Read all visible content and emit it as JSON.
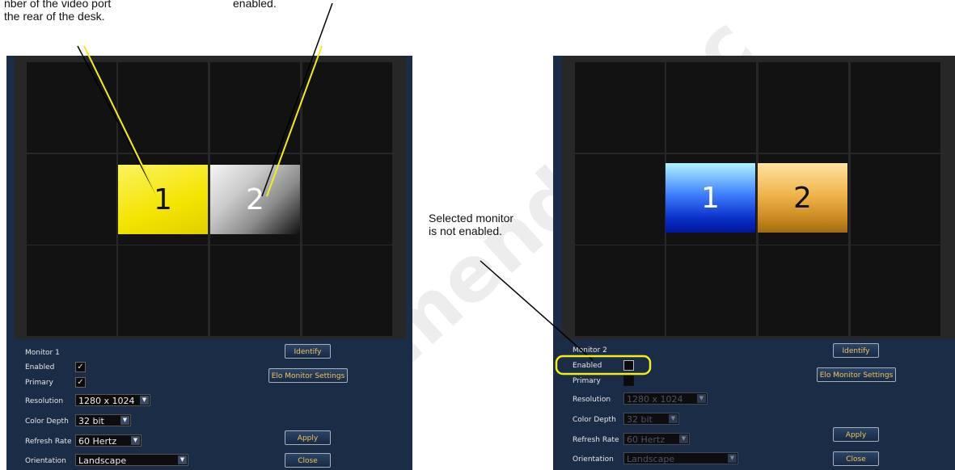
{
  "callouts": {
    "left": "nber of the video port\nthe rear of the desk.",
    "middle": "enabled.",
    "right": "Selected monitor\nis not enabled."
  },
  "watermark": "osmendoza.c",
  "left": {
    "title": "Monitor 1",
    "enabled_label": "Enabled",
    "enabled": true,
    "primary_label": "Primary",
    "primary": true,
    "resolution_label": "Resolution",
    "resolution": "1280 x 1024",
    "color_depth_label": "Color Depth",
    "color_depth": "32 bit",
    "refresh_label": "Refresh Rate",
    "refresh": "60 Hertz",
    "orientation_label": "Orientation",
    "orientation": "Landscape",
    "identify": "Identify",
    "elo": "Elo Monitor Settings",
    "apply": "Apply",
    "close": "Close",
    "mon1": "1",
    "mon2": "2",
    "check": "✓"
  },
  "right": {
    "title": "Monitor 2",
    "enabled_label": "Enabled",
    "enabled": false,
    "primary_label": "Primary",
    "primary": false,
    "resolution_label": "Resolution",
    "resolution": "1280 x 1024",
    "color_depth_label": "Color Depth",
    "color_depth": "32 bit",
    "refresh_label": "Refresh Rate",
    "refresh": "60 Hertz",
    "orientation_label": "Orientation",
    "orientation": "Landscape",
    "identify": "Identify",
    "elo": "Elo Monitor Settings",
    "apply": "Apply",
    "close": "Close",
    "mon1": "1",
    "mon2": "2"
  },
  "colors": {
    "highlight": "#f5ec1a",
    "button_text": "#f2c35c",
    "panel": "#1b2c46"
  }
}
